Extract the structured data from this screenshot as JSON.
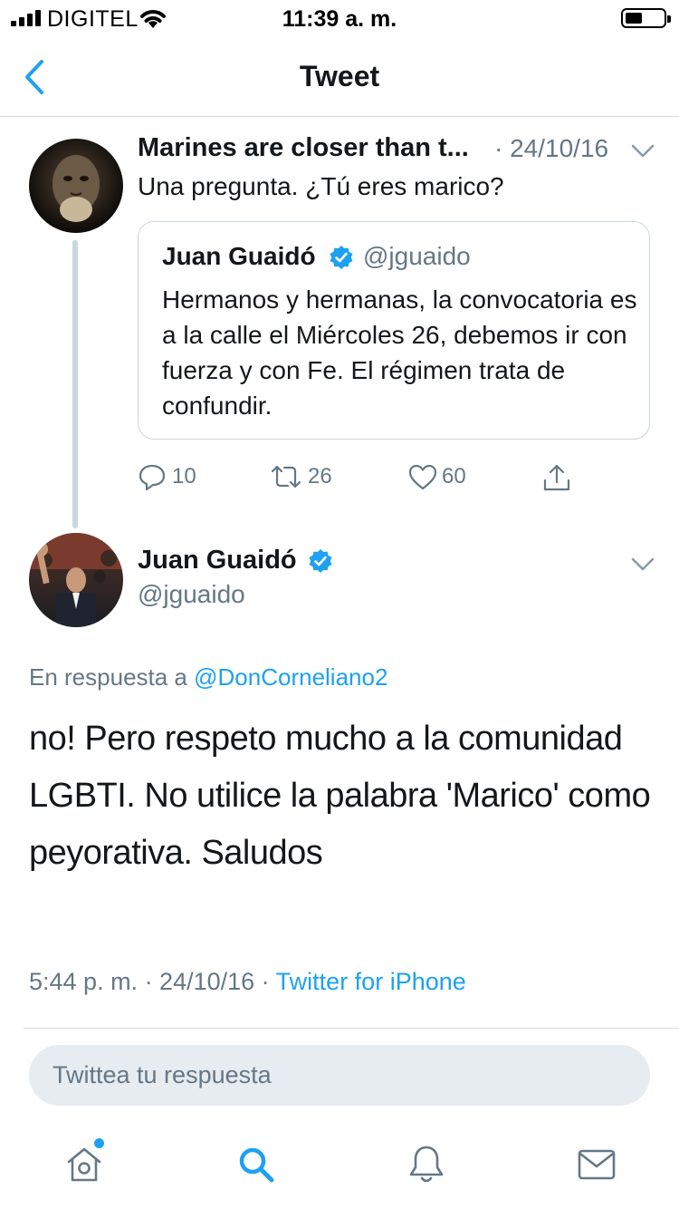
{
  "status_bar": {
    "carrier": "DIGITEL",
    "time": "11:39 a. m.",
    "battery_level": 0.35
  },
  "nav": {
    "title": "Tweet",
    "back_icon": "chevron-left-icon"
  },
  "parent_tweet": {
    "author_name": "Marines are closer than t...",
    "date": "· 24/10/16",
    "text": "Una pregunta. ¿Tú eres marico?",
    "quoted": {
      "name": "Juan Guaidó",
      "handle": "@jguaido",
      "verified": true,
      "text": "Hermanos y hermanas, la convocatoria es a la calle el Miércoles 26, debemos ir con fuerza y con Fe. El régimen trata de confundir."
    },
    "actions": {
      "replies": "10",
      "retweets": "26",
      "likes": "60"
    }
  },
  "main_tweet": {
    "name": "Juan Guaidó",
    "handle": "@jguaido",
    "verified": true,
    "reply_to_prefix": "En respuesta a ",
    "reply_to_mention": "@DonCorneliano2",
    "text": "no! Pero respeto mucho a la comunidad LGBTI. No utilice la palabra 'Marico' como peyorativa. Saludos",
    "timestamp": "5:44 p. m. · 24/10/16 · ",
    "source": "Twitter for iPhone"
  },
  "reply_box": {
    "placeholder": "Twittea tu respuesta"
  },
  "tab_bar": {
    "items": [
      "home-icon",
      "search-icon",
      "bell-icon",
      "mail-icon"
    ],
    "active": "search-icon"
  },
  "colors": {
    "accent": "#1da1f2",
    "text": "#14171a",
    "secondary": "#657786",
    "border": "#ccd6dd"
  }
}
